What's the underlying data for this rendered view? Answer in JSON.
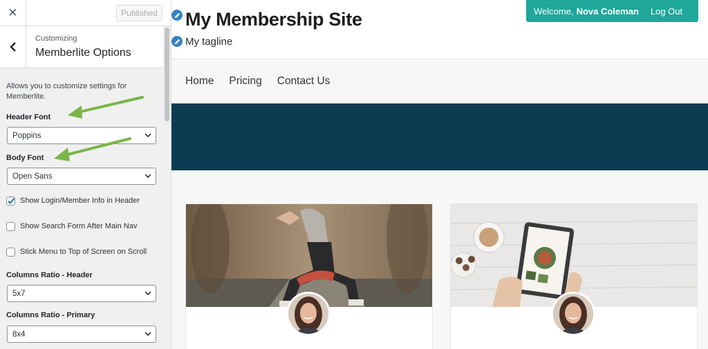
{
  "customizer": {
    "close_icon": "close-icon",
    "published_label": "Published",
    "back_icon": "chevron-left-icon",
    "subtitle": "Customizing",
    "title": "Memberlite Options",
    "description": "Allows you to customize settings for Memberlite.",
    "header_font": {
      "label": "Header Font",
      "value": "Poppins"
    },
    "body_font": {
      "label": "Body Font",
      "value": "Open Sans"
    },
    "checkboxes": [
      {
        "label": "Show Login/Member Info in Header",
        "checked": true
      },
      {
        "label": "Show Search Form After Main Nav",
        "checked": false
      },
      {
        "label": "Stick Menu to Top of Screen on Scroll",
        "checked": false
      }
    ],
    "columns_header": {
      "label": "Columns Ratio - Header",
      "value": "5x7"
    },
    "columns_primary": {
      "label": "Columns Ratio - Primary",
      "value": "8x4"
    },
    "arrow_color": "#7ab648"
  },
  "site": {
    "title": "My Membership Site",
    "tagline": "My tagline",
    "edit_icon": "pencil-icon",
    "member": {
      "welcome": "Welcome,",
      "name": "Nova Coleman",
      "logout": "Log Out",
      "color": "#1fa79a"
    },
    "nav": [
      "Home",
      "Pricing",
      "Contact Us"
    ],
    "banner_color": "#0b3c52"
  }
}
